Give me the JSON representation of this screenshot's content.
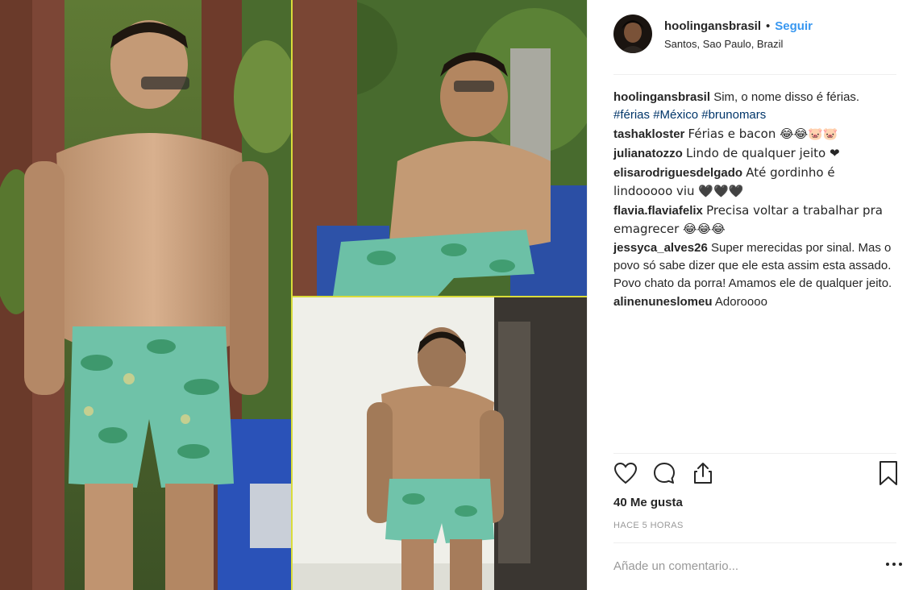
{
  "post": {
    "username": "hoolingansbrasil",
    "dot": "•",
    "follow_label": "Seguir",
    "location": "Santos, Sao Paulo, Brazil",
    "likes": "40 Me gusta",
    "time_ago": "HACE 5 HORAS",
    "add_comment_placeholder": "Añade un comentario..."
  },
  "caption": {
    "username": "hoolingansbrasil",
    "text": "Sim, o nome disso é férias.",
    "hashtags": [
      "#férias",
      "#México",
      "#brunomars"
    ]
  },
  "comments": [
    {
      "username": "tashakloster",
      "text": "Férias e bacon 😂😂🐷🐷"
    },
    {
      "username": "julianatozzo",
      "text": "Lindo de qualquer jeito ❤"
    },
    {
      "username": "elisarodriguesdelgado",
      "text": "Até gordinho é lindooooo viu �along"
    },
    {
      "username": "flavia.flaviafelix",
      "text": "Precisa voltar a trabalhar pra emagrecer 😂😂😂"
    },
    {
      "username": "jessyca_alves26",
      "text": "Super merecidas por sinal. Mas o povo só sabe dizer que ele esta assim esta assado. Povo chato da porra! Amamos ele de qualquer jeito."
    },
    {
      "username": "alinenuneslomeu",
      "text": "Adoroooo"
    }
  ],
  "icons": {
    "like": "heart-icon",
    "comment": "comment-icon",
    "share": "share-icon",
    "save": "bookmark-icon",
    "more": "more-options-icon"
  },
  "colors": {
    "link": "#3897f0",
    "hashtag": "#003569",
    "muted": "#999999",
    "divider": "#d9dc3a"
  }
}
